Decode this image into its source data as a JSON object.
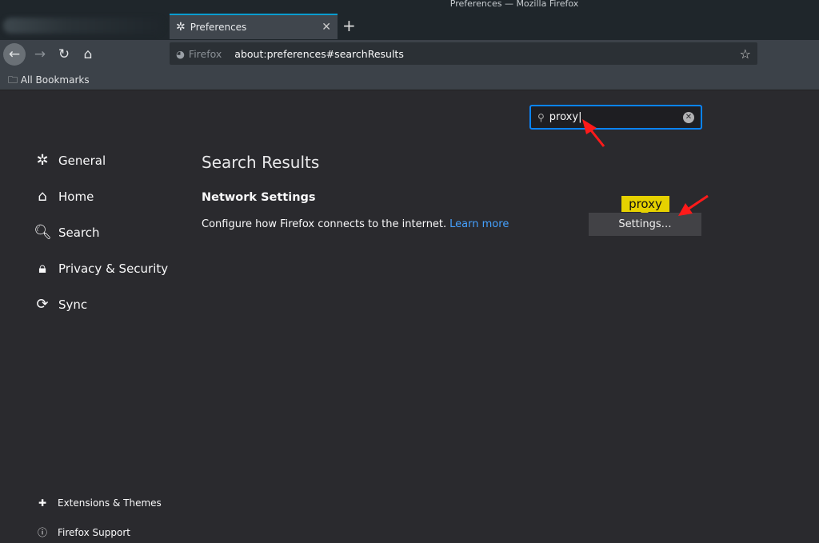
{
  "window": {
    "title": "Preferences — Mozilla Firefox"
  },
  "tabs": [
    {
      "label": "Preferences",
      "icon": "gear-icon"
    }
  ],
  "urlbar": {
    "identity": "Firefox",
    "url": "about:preferences#searchResults"
  },
  "bookmarks": {
    "label": "All Bookmarks"
  },
  "search": {
    "value": "proxy"
  },
  "sidebar": {
    "items": [
      {
        "label": "General",
        "icon": "gear-icon"
      },
      {
        "label": "Home",
        "icon": "home-icon"
      },
      {
        "label": "Search",
        "icon": "search-icon"
      },
      {
        "label": "Privacy & Security",
        "icon": "lock-icon"
      },
      {
        "label": "Sync",
        "icon": "sync-icon"
      }
    ],
    "footer": [
      {
        "label": "Extensions & Themes",
        "icon": "puzzle-icon"
      },
      {
        "label": "Firefox Support",
        "icon": "help-icon"
      }
    ]
  },
  "main": {
    "title": "Search Results",
    "section": "Network Settings",
    "description": "Configure how Firefox connects to the internet.",
    "learn_more": "Learn more",
    "highlight": "proxy",
    "settings_button": "Settings…"
  },
  "colors": {
    "accent": "#0a84ff",
    "highlight": "#e6d100",
    "annotation": "#ff0000"
  }
}
